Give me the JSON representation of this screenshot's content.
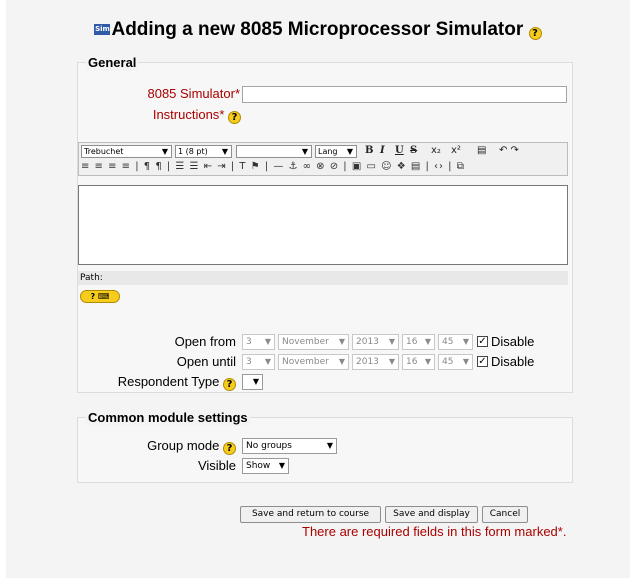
{
  "page": {
    "title": "Adding a new 8085 Microprocessor Simulator",
    "module_icon": "Sim",
    "help_glyph": "?"
  },
  "general": {
    "legend": "General",
    "simulator_label": "8085 Simulator",
    "instructions_label": "Instructions",
    "required_mark": "*",
    "simulator_value": ""
  },
  "editor": {
    "font_family": "Trebuchet",
    "font_size": "1 (8 pt)",
    "style": "",
    "lang": "Lang",
    "bold": "B",
    "italic": "I",
    "underline": "U",
    "strike": "S",
    "subscript": "x₂",
    "superscript": "x²",
    "undo_redo": "↶ ↷",
    "row2_icons": "≡ ≡ ≡ ≡ | ¶ ¶ | ☰ ☰ ⇤ ⇥ | T ⚑ | — ⚓ ∞ ⊗ ⊘ | ▣ ▭ ☺ ❖ ▤ | ‹› | ⧉",
    "path_label": "Path:",
    "content": ""
  },
  "dates": {
    "open_from_label": "Open from",
    "open_until_label": "Open until",
    "respondent_type_label": "Respondent Type",
    "open_from": {
      "day": "3",
      "month": "November",
      "year": "2013",
      "hour": "16",
      "minute": "45"
    },
    "open_until": {
      "day": "3",
      "month": "November",
      "year": "2013",
      "hour": "16",
      "minute": "45"
    },
    "disable_label": "Disable",
    "respondent_type_value": ""
  },
  "common": {
    "legend": "Common module settings",
    "group_mode_label": "Group mode",
    "group_mode_value": "No groups",
    "visible_label": "Visible",
    "visible_value": "Show"
  },
  "actions": {
    "save_return": "Save and return to course",
    "save_display": "Save and display",
    "cancel": "Cancel",
    "required_note": "There are required fields in this form marked*."
  },
  "colors": {
    "required": "#aa0000",
    "help_icon": "#f6cd1c",
    "panel_bg": "#f4f4f4"
  }
}
